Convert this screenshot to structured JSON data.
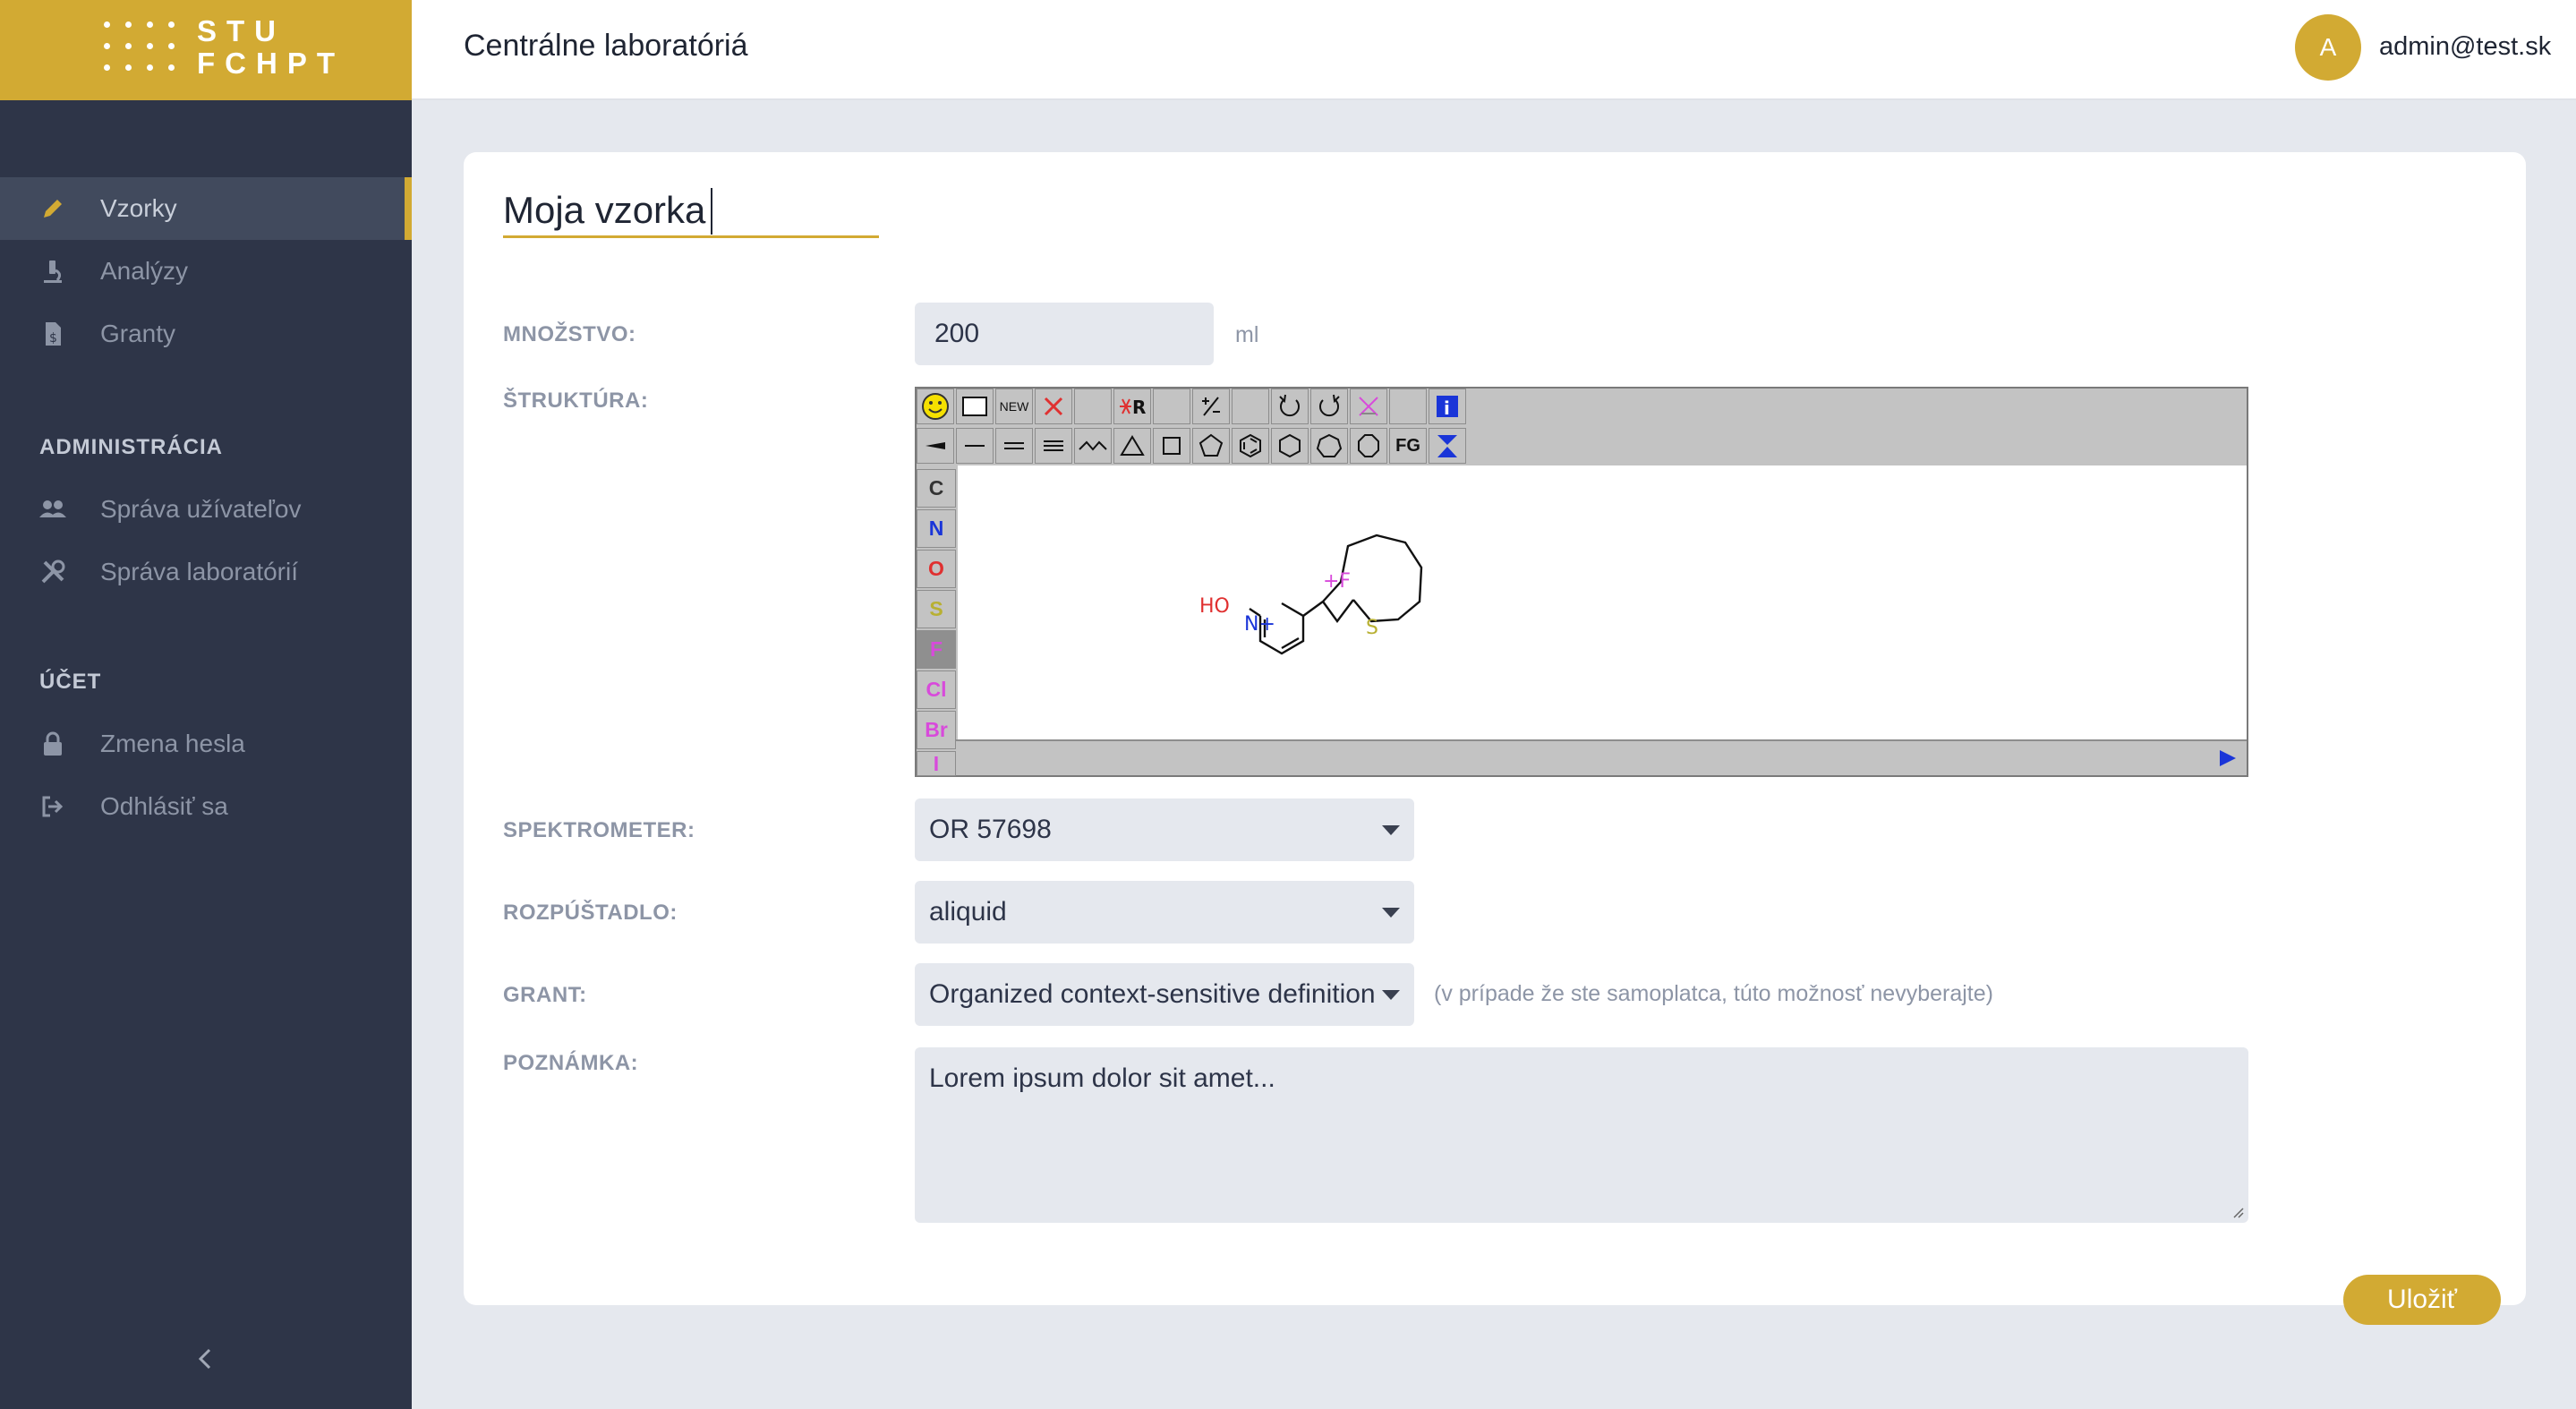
{
  "brand": {
    "line1": "STU",
    "line2": "FCHPT",
    "color": "#d2aa33"
  },
  "header": {
    "title": "Centrálne laboratóriá",
    "avatar_initial": "A",
    "user_email": "admin@test.sk"
  },
  "sidebar": {
    "main_items": [
      {
        "label": "Vzorky",
        "icon": "pencil-icon",
        "active": true
      },
      {
        "label": "Analýzy",
        "icon": "microscope-icon",
        "active": false
      },
      {
        "label": "Granty",
        "icon": "document-dollar-icon",
        "active": false
      }
    ],
    "admin_heading": "ADMINISTRÁCIA",
    "admin_items": [
      {
        "label": "Správa užívateľov",
        "icon": "users-icon"
      },
      {
        "label": "Správa laboratórií",
        "icon": "tools-icon"
      }
    ],
    "account_heading": "ÚČET",
    "account_items": [
      {
        "label": "Zmena hesla",
        "icon": "lock-icon"
      },
      {
        "label": "Odhlásiť sa",
        "icon": "sign-out-icon"
      }
    ],
    "collapse_icon": "chevron-left-icon"
  },
  "form": {
    "sample_name": "Moja vzorka",
    "quantity": {
      "label": "MNOŽSTVO:",
      "value": "200",
      "unit": "ml"
    },
    "structure": {
      "label": "ŠTRUKTÚRA:",
      "toolbar_new": "NEW",
      "toolbar_fg": "FG",
      "atoms": [
        "C",
        "N",
        "O",
        "S",
        "F",
        "Cl",
        "Br",
        "I"
      ],
      "molecule_labels": {
        "ho": "HO",
        "nplus": "N+",
        "fplus": "+F",
        "s": "S"
      }
    },
    "spectrometer": {
      "label": "SPEKTROMETER:",
      "value": "OR 57698"
    },
    "solvent": {
      "label": "ROZPÚŠTADLO:",
      "value": "aliquid"
    },
    "grant": {
      "label": "GRANT:",
      "value": "Organized context-sensitive definition",
      "hint": "(v prípade že ste samoplatca, túto možnosť nevyberajte)"
    },
    "note": {
      "label": "POZNÁMKA:",
      "value": "Lorem ipsum dolor sit amet..."
    },
    "save_label": "Uložiť"
  }
}
